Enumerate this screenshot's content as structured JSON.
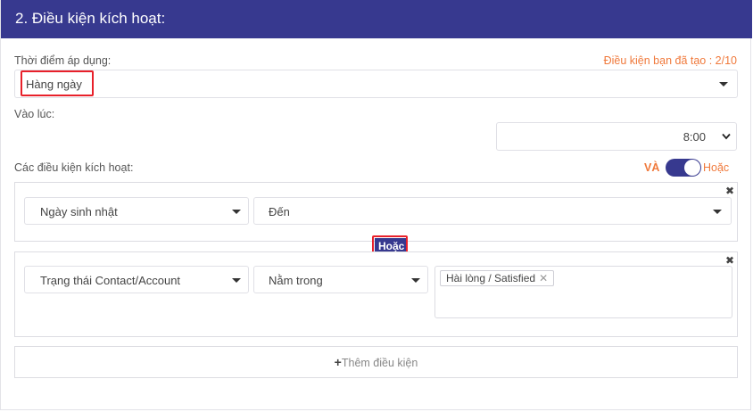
{
  "header": {
    "title": "2. Điều kiện kích hoạt:"
  },
  "apply_time": {
    "label": "Thời điểm áp dụng:",
    "counter": "Điều kiện bạn đã tạo : 2/10",
    "selected": "Hàng ngày"
  },
  "at_time": {
    "label": "Vào lúc:",
    "selected": "8:00"
  },
  "conditions": {
    "label": "Các điều kiện kích hoạt:",
    "and_label": "VÀ",
    "or_label": "Hoặc",
    "toggle_state": "Hoặc"
  },
  "groups": [
    {
      "field": "Ngày sinh nhật",
      "operator": "Đến",
      "close": "✖"
    },
    {
      "field": "Trạng thái Contact/Account",
      "operator": "Nằm trong",
      "values": [
        "Hài lòng / Satisfied"
      ],
      "close": "✖"
    }
  ],
  "connector": "Hoặc",
  "add_button": {
    "plus": "+",
    "label": "Thêm điều kiện"
  },
  "colors": {
    "header": "#37398f",
    "accent_orange": "#f0793b",
    "highlight_red": "#e8202a"
  }
}
